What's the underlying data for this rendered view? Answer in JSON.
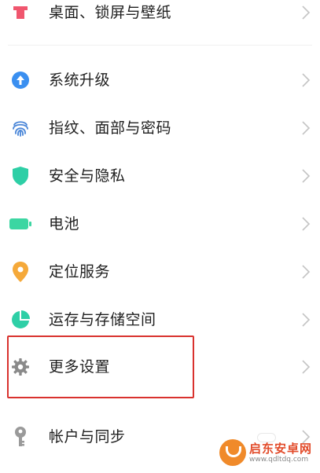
{
  "settings": {
    "items": [
      {
        "label": "桌面、锁屏与壁纸",
        "icon": "wallpaper-icon"
      },
      {
        "label": "系统升级",
        "icon": "upgrade-arrow-icon"
      },
      {
        "label": "指纹、面部与密码",
        "icon": "fingerprint-icon"
      },
      {
        "label": "安全与隐私",
        "icon": "shield-icon"
      },
      {
        "label": "电池",
        "icon": "battery-icon"
      },
      {
        "label": "定位服务",
        "icon": "location-pin-icon"
      },
      {
        "label": "运存与存储空间",
        "icon": "storage-pie-icon"
      },
      {
        "label": "更多设置",
        "icon": "gear-icon"
      },
      {
        "label": "帐户与同步",
        "icon": "key-icon"
      }
    ]
  },
  "watermark": {
    "name": "启东安卓网",
    "url": "www.qdltdq.com"
  },
  "colors": {
    "wallpaper": "#f0566e",
    "upgrade": "#3a8ff0",
    "fingerprint": "#4a86d8",
    "shield": "#2ecfa6",
    "battery": "#3cd6a2",
    "location": "#f5a93a",
    "storage": "#2ecfa6",
    "gear": "#8a8a8a",
    "key": "#9a9a9a",
    "highlight": "#d9322e",
    "chevron": "#c4c4c4"
  }
}
